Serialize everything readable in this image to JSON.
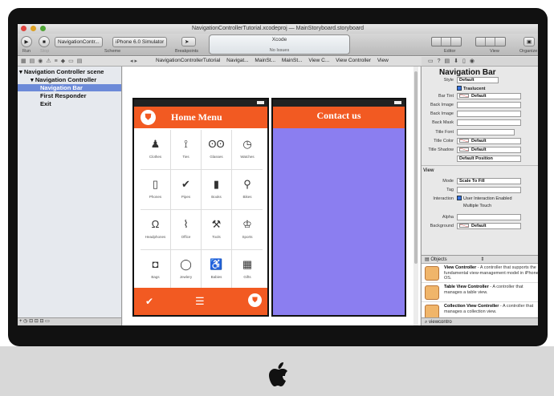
{
  "window": {
    "title": "NavigationControllerTutorial.xcodeproj — MainStoryboard.storyboard",
    "lcd_app": "Xcode",
    "lcd_status": "No Issues"
  },
  "toolbar": {
    "run_label": "Run",
    "stop_label": "Stop",
    "scheme_target": "NavigationContr...",
    "scheme_device": "iPhone 6.0 Simulator",
    "scheme_label": "Scheme",
    "breakpoints_label": "Breakpoints",
    "editor_label": "Editor",
    "view_label": "View",
    "organizer_label": "Organize"
  },
  "jumpbar": {
    "items": [
      "NavigationControllerTutorial",
      "Navigat...",
      "MainSt...",
      "MainSt...",
      "View C...",
      "View Controller",
      "View"
    ]
  },
  "outline": {
    "scene": "Navigation Controller scene",
    "controller": "Navigation Controller",
    "selected": "Navigation Bar",
    "first_responder": "First Responder",
    "exit": "Exit"
  },
  "canvas": {
    "home_title": "Home Menu",
    "contact_title": "Contact us",
    "grid": [
      {
        "icon": "person-icon",
        "glyph": "♟",
        "label": "Clothes"
      },
      {
        "icon": "tie-icon",
        "glyph": "⟟",
        "label": "Ties"
      },
      {
        "icon": "glasses-icon",
        "glyph": "ʘʘ",
        "label": "Glasses"
      },
      {
        "icon": "watch-icon",
        "glyph": "◷",
        "label": "Watches"
      },
      {
        "icon": "phone-icon",
        "glyph": "▯",
        "label": "Phones"
      },
      {
        "icon": "check-icon",
        "glyph": "✔",
        "label": "Pipes"
      },
      {
        "icon": "book-icon",
        "glyph": "▮",
        "label": "Books"
      },
      {
        "icon": "bike-icon",
        "glyph": "⚲",
        "label": "Bikes"
      },
      {
        "icon": "headphones-icon",
        "glyph": "Ω",
        "label": "Headphones"
      },
      {
        "icon": "paperclip-icon",
        "glyph": "⌇",
        "label": "Office"
      },
      {
        "icon": "hammer-icon",
        "glyph": "⚒",
        "label": "Tools"
      },
      {
        "icon": "trophy-icon",
        "glyph": "♔",
        "label": "Sports"
      },
      {
        "icon": "bag-icon",
        "glyph": "◘",
        "label": "Bags"
      },
      {
        "icon": "ring-icon",
        "glyph": "◯",
        "label": "Jewlery"
      },
      {
        "icon": "stroller-icon",
        "glyph": "♿",
        "label": "Babies"
      },
      {
        "icon": "gift-icon",
        "glyph": "▦",
        "label": "Gifts"
      }
    ],
    "tab_icons": [
      "check-icon",
      "menu-icon",
      "bag-icon"
    ],
    "orange": "#f25a22",
    "contact_bg": "#8b7ef0"
  },
  "inspector": {
    "title": "Navigation Bar",
    "style_label": "Style",
    "style_value": "Default",
    "translucent_label": "Traslucent",
    "bar_tint_label": "Bar Tint",
    "bar_tint_value": "Default",
    "back_image_label": "Back Image",
    "back_image2_label": "Back Image",
    "back_mask_label": "Back Mask",
    "title_font_label": "Title Font",
    "title_color_label": "Title Color",
    "title_color_value": "Default",
    "title_shadow_label": "Title Shadow",
    "title_shadow_value": "Default",
    "default_position": "Default Position",
    "view_section": "View",
    "mode_label": "Mode",
    "mode_value": "Scale To Fill",
    "tag_label": "Tag",
    "interaction_label": "Interaction",
    "interaction_enabled": "User Interaction Enabled",
    "multiple_touch": "Multiple Touch",
    "alpha_label": "Alpha",
    "background_label": "Background",
    "background_value": "Default"
  },
  "library": {
    "selector": "Objects",
    "items": [
      {
        "name": "View Controller",
        "desc": " - A controller that supports the fundamental view-management model in iPhone OS."
      },
      {
        "name": "Table View Controller",
        "desc": " - A controller that manages a table view."
      },
      {
        "name": "Collection View Controller",
        "desc": " - A controller that manages a collection view."
      }
    ],
    "filter": "viewcontro"
  }
}
